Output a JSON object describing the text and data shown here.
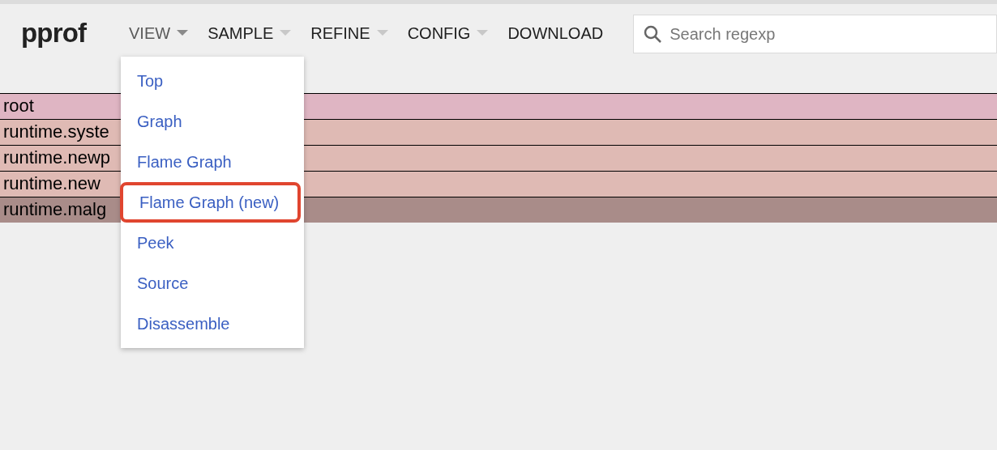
{
  "logo": "pprof",
  "nav": [
    {
      "label": "VIEW",
      "has_menu": true,
      "open": true
    },
    {
      "label": "SAMPLE",
      "has_menu": true,
      "open": false
    },
    {
      "label": "REFINE",
      "has_menu": true,
      "open": false
    },
    {
      "label": "CONFIG",
      "has_menu": true,
      "open": false
    },
    {
      "label": "DOWNLOAD",
      "has_menu": false,
      "open": false
    }
  ],
  "search": {
    "placeholder": "Search regexp"
  },
  "flame_rows": [
    {
      "label": "root",
      "color": "#dfb5c3"
    },
    {
      "label": "runtime.syste",
      "color": "#dfbab4"
    },
    {
      "label": "runtime.newp",
      "color": "#dfbab4"
    },
    {
      "label": "runtime.new",
      "color": "#dfbab4"
    },
    {
      "label": "runtime.malg",
      "color": "#a98c89"
    }
  ],
  "view_menu": [
    {
      "label": "Top",
      "highlighted": false
    },
    {
      "label": "Graph",
      "highlighted": false
    },
    {
      "label": "Flame Graph",
      "highlighted": false
    },
    {
      "label": "Flame Graph (new)",
      "highlighted": true
    },
    {
      "label": "Peek",
      "highlighted": false
    },
    {
      "label": "Source",
      "highlighted": false
    },
    {
      "label": "Disassemble",
      "highlighted": false
    }
  ]
}
